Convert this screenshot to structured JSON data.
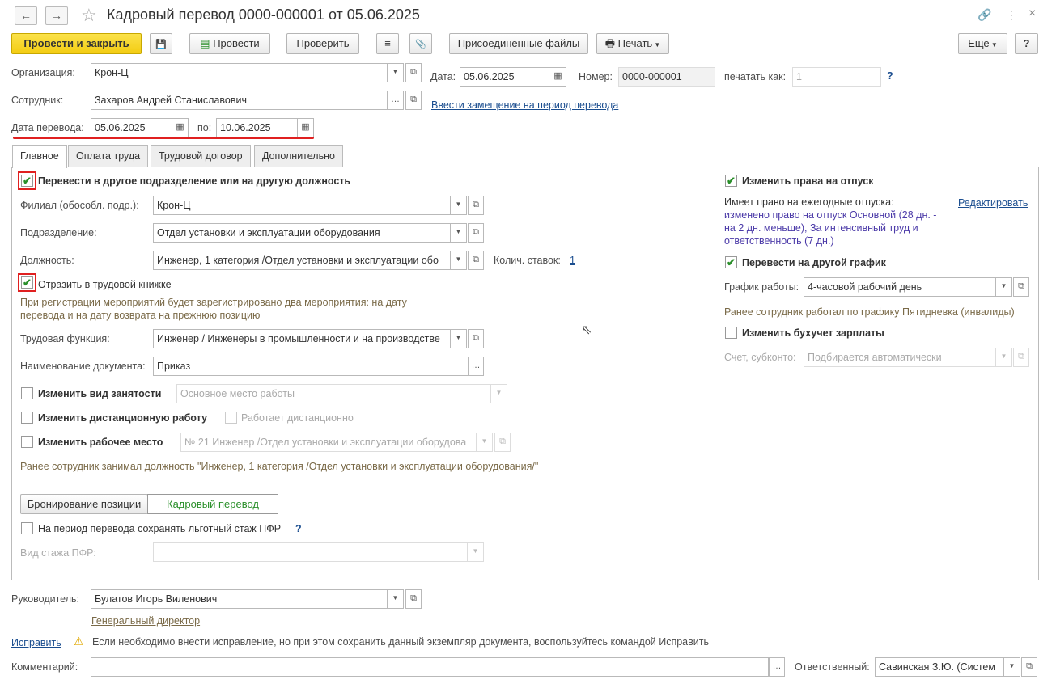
{
  "window": {
    "title": "Кадровый перевод 0000-000001 от 05.06.2025",
    "back_icon": "←",
    "forward_icon": "→",
    "star_icon": "☆",
    "link_icon": "🔗",
    "more_icon": "⋮",
    "close_icon": "×"
  },
  "toolbar": {
    "post_close": "Провести и закрыть",
    "save_icon": "💾",
    "post": "Провести",
    "check": "Проверить",
    "list_icon": "≡",
    "attach_icon": "📎",
    "files": "Присоединенные файлы",
    "print": "Печать",
    "more": "Еще",
    "help": "?"
  },
  "header": {
    "org_label": "Организация:",
    "org_value": "Крон-Ц",
    "date_label": "Дата:",
    "date_value": "05.06.2025",
    "number_label": "Номер:",
    "number_value": "0000-000001",
    "print_as_label": "печатать как:",
    "print_as_value": "1",
    "print_help": "?",
    "employee_label": "Сотрудник:",
    "employee_value": "Захаров Андрей Станиславович",
    "replace_link": "Ввести замещение на период перевода",
    "transfer_date_label": "Дата перевода:",
    "transfer_from": "05.06.2025",
    "to_label": "по:",
    "transfer_to": "10.06.2025"
  },
  "tabs": [
    {
      "label": "Главное"
    },
    {
      "label": "Оплата труда"
    },
    {
      "label": "Трудовой договор"
    },
    {
      "label": "Дополнительно"
    }
  ],
  "main": {
    "transfer_checkbox": "Перевести в другое подразделение или на другую должность",
    "branch_label": "Филиал (обособл. подр.):",
    "branch_value": "Крон-Ц",
    "dept_label": "Подразделение:",
    "dept_value": "Отдел установки и эксплуатации оборудования",
    "position_label": "Должность:",
    "position_value": "Инженер, 1 категория /Отдел установки и эксплуатации обо",
    "rate_label": "Колич. ставок:",
    "rate_value": "1",
    "workbook_checkbox": "Отразить в трудовой книжке",
    "workbook_hint_1": "При регистрации мероприятий будет зарегистрировано два мероприятия: на дату",
    "workbook_hint_2": "перевода и на дату возврата на прежнюю позицию",
    "labor_func_label": "Трудовая функция:",
    "labor_func_value": "Инженер / Инженеры в промышленности и на производстве",
    "doc_name_label": "Наименование документа:",
    "doc_name_value": "Приказ",
    "employment_checkbox": "Изменить вид занятости",
    "employment_value": "Основное место работы",
    "remote_checkbox": "Изменить дистанционную работу",
    "remote_value": "Работает дистанционно",
    "workplace_checkbox": "Изменить рабочее место",
    "workplace_value": "№ 21 Инженер /Отдел установки и эксплуатации оборудова",
    "prev_position_hint": "Ранее сотрудник занимал должность \"Инженер, 1 категория /Отдел установки и эксплуатации оборудования/\"",
    "booking_button": "Бронирование позиции",
    "transfer_button": "Кадровый перевод",
    "pfr_checkbox": "На период перевода сохранять льготный стаж ПФР",
    "pfr_help": "?",
    "pfr_type_label": "Вид стажа ПФР:",
    "pfr_type_value": ""
  },
  "right": {
    "vacation_checkbox": "Изменить права на отпуск",
    "vacation_title": "Имеет право на ежегодные отпуска:",
    "vacation_edit": "Редактировать",
    "vacation_text_1": "изменено право на отпуск Основной (28 дн. -",
    "vacation_text_2": "на 2 дн. меньше), За интенсивный труд и",
    "vacation_text_3": "ответственность (7 дн.)",
    "schedule_checkbox": "Перевести на другой график",
    "schedule_label": "График работы:",
    "schedule_value": "4-часовой рабочий день",
    "schedule_hint": "Ранее сотрудник работал по графику Пятидневка (инвалиды)",
    "accounting_checkbox": "Изменить бухучет зарплаты",
    "account_label": "Счет, субконто:",
    "account_placeholder": "Подбирается автоматически"
  },
  "footer": {
    "manager_label": "Руководитель:",
    "manager_value": "Булатов Игорь Виленович",
    "manager_title": "Генеральный директор",
    "fix_link": "Исправить",
    "warning_icon": "⚠",
    "fix_hint": "Если необходимо внести исправление, но при этом сохранить данный экземпляр документа, воспользуйтесь командой Исправить",
    "comment_label": "Комментарий:",
    "comment_value": "",
    "responsible_label": "Ответственный:",
    "responsible_value": "Савинская З.Ю. (Систем"
  },
  "colors": {
    "accent_yellow": "#f5d020",
    "link": "#1a4d8f",
    "hint": "#7a6a48",
    "highlight_red": "#e02020",
    "check_green": "#2a8f2a"
  }
}
